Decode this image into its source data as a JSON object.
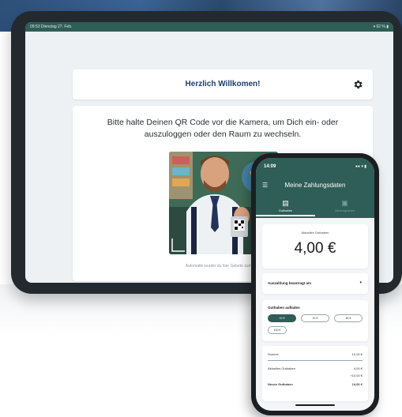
{
  "tablet": {
    "status_bar": {
      "time_date": "09:53 Dienstag 27. Feb.",
      "battery": "▾ 62 % ▮"
    },
    "welcome_title": "Herzlich Willkomen!",
    "instruction": "Bitte halte Deinen QR Code vor die Kamera, um Dich ein- oder auszuloggen oder den Raum zu wechseln.",
    "camera_footer": "Automatik wurde/ du hier Gebete zum Test"
  },
  "phone": {
    "status": {
      "time": "14:09",
      "icons": "●● ▾ ▮"
    },
    "title": "Meine Zahlungsdaten",
    "tabs": [
      {
        "label": "Guthaben",
        "icon": "wallet-icon"
      },
      {
        "label": "Zahlungsarten",
        "icon": "document-icon"
      }
    ],
    "balance_label": "Aktuelles Guthaben",
    "balance_value": "4,00 €",
    "payout_label": "Auszahlung beantragt am",
    "topup": {
      "label": "Guthaben aufladen",
      "options": [
        "10 €",
        "20 €",
        "50 €",
        "100 €"
      ]
    },
    "summary": {
      "rows": [
        {
          "label": "Summe",
          "value": "10,00 €"
        },
        {
          "label": "Aktuelles Guthaben",
          "value": "4,00 €"
        },
        {
          "label": "",
          "value": "+10,00 €"
        },
        {
          "label": "Neues Guthaben",
          "value": "14,00 €"
        }
      ]
    }
  },
  "colors": {
    "brand": "#2f5d57",
    "tablet_title": "#1e3f6e"
  }
}
